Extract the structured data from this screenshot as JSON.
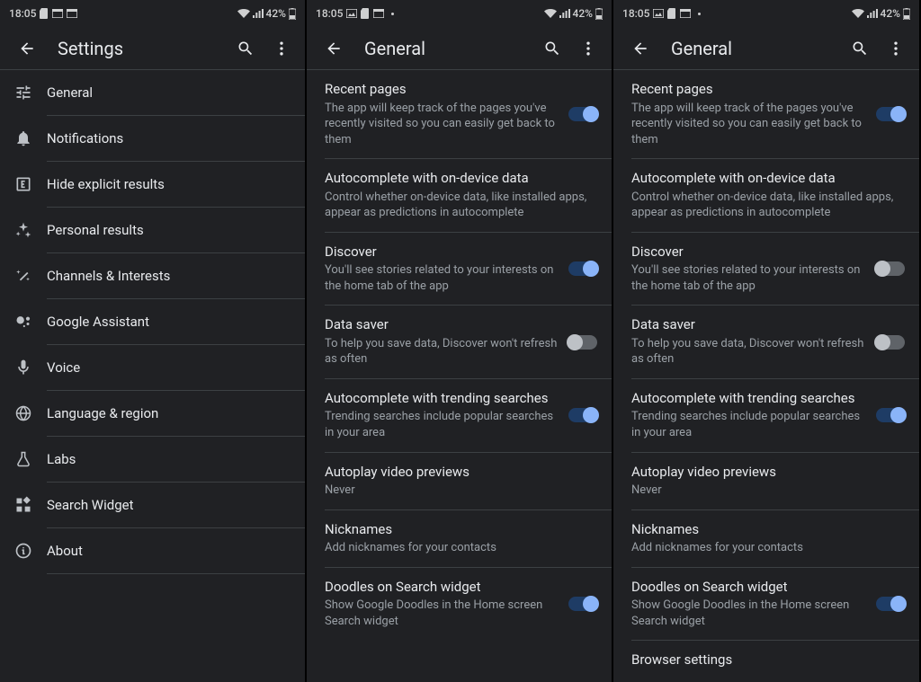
{
  "status": {
    "time": "18:05",
    "battery": "42%"
  },
  "pane1": {
    "title": "Settings",
    "items": [
      {
        "label": "General"
      },
      {
        "label": "Notifications"
      },
      {
        "label": "Hide explicit results"
      },
      {
        "label": "Personal results"
      },
      {
        "label": "Channels & Interests"
      },
      {
        "label": "Google Assistant"
      },
      {
        "label": "Voice"
      },
      {
        "label": "Language & region"
      },
      {
        "label": "Labs"
      },
      {
        "label": "Search Widget"
      },
      {
        "label": "About"
      }
    ]
  },
  "pane2": {
    "title": "General",
    "items": [
      {
        "title": "Recent pages",
        "sub": "The app will keep track of the pages you've recently visited so you can easily get back to them",
        "toggle": "on"
      },
      {
        "title": "Autocomplete with on-device data",
        "sub": "Control whether on-device data, like installed apps, appear as predictions in autocomplete"
      },
      {
        "title": "Discover",
        "sub": "You'll see stories related to your interests on the home tab of the app",
        "toggle": "on"
      },
      {
        "title": "Data saver",
        "sub": "To help you save data, Discover won't refresh as often",
        "toggle": "off"
      },
      {
        "title": "Autocomplete with trending searches",
        "sub": "Trending searches include popular searches in your area",
        "toggle": "on"
      },
      {
        "title": "Autoplay video previews",
        "sub": "Never"
      },
      {
        "title": "Nicknames",
        "sub": "Add nicknames for your contacts"
      },
      {
        "title": "Doodles on Search widget",
        "sub": "Show Google Doodles in the Home screen Search widget",
        "toggle": "on"
      }
    ]
  },
  "pane3": {
    "title": "General",
    "items": [
      {
        "title": "Recent pages",
        "sub": "The app will keep track of the pages you've recently visited so you can easily get back to them",
        "toggle": "on"
      },
      {
        "title": "Autocomplete with on-device data",
        "sub": "Control whether on-device data, like installed apps, appear as predictions in autocomplete"
      },
      {
        "title": "Discover",
        "sub": "You'll see stories related to your interests on the home tab of the app",
        "toggle": "off"
      },
      {
        "title": "Data saver",
        "sub": "To help you save data, Discover won't refresh as often",
        "toggle": "off"
      },
      {
        "title": "Autocomplete with trending searches",
        "sub": "Trending searches include popular searches in your area",
        "toggle": "on"
      },
      {
        "title": "Autoplay video previews",
        "sub": "Never"
      },
      {
        "title": "Nicknames",
        "sub": "Add nicknames for your contacts"
      },
      {
        "title": "Doodles on Search widget",
        "sub": "Show Google Doodles in the Home screen Search widget",
        "toggle": "on"
      },
      {
        "title": "Browser settings"
      }
    ]
  }
}
